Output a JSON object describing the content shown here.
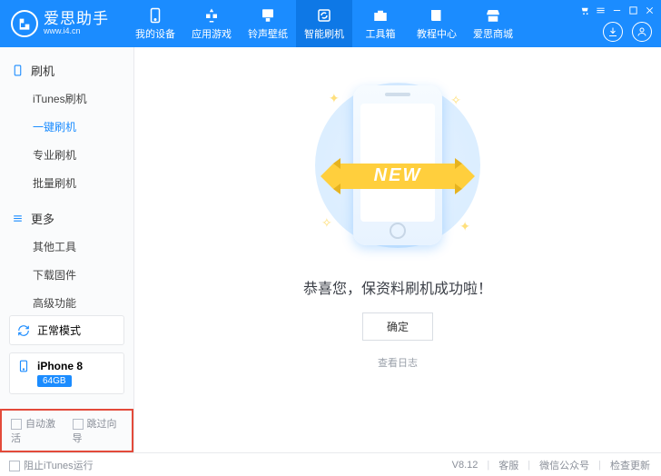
{
  "header": {
    "logo_title": "爱思助手",
    "logo_url": "www.i4.cn",
    "nav": [
      {
        "label": "我的设备",
        "icon": "phone"
      },
      {
        "label": "应用游戏",
        "icon": "apps"
      },
      {
        "label": "铃声壁纸",
        "icon": "music"
      },
      {
        "label": "智能刷机",
        "icon": "refresh"
      },
      {
        "label": "工具箱",
        "icon": "toolbox"
      },
      {
        "label": "教程中心",
        "icon": "book"
      },
      {
        "label": "爱思商城",
        "icon": "store"
      }
    ],
    "nav_active_index": 3
  },
  "sys_icons": [
    "cart-icon",
    "menu-icon",
    "minimize-icon",
    "maximize-icon",
    "close-icon"
  ],
  "header_circles": [
    "download-icon",
    "user-icon"
  ],
  "sidebar": {
    "groups": [
      {
        "title": "刷机",
        "icon": "phone",
        "items": [
          "iTunes刷机",
          "一键刷机",
          "专业刷机",
          "批量刷机"
        ],
        "active_index": 1
      },
      {
        "title": "更多",
        "icon": "more",
        "items": [
          "其他工具",
          "下载固件",
          "高级功能"
        ],
        "active_index": -1
      }
    ],
    "mode": {
      "label": "正常模式"
    },
    "device": {
      "name": "iPhone 8",
      "capacity": "64GB"
    },
    "opts": {
      "auto_activate": "自动激活",
      "skip_guide": "跳过向导"
    }
  },
  "content": {
    "ribbon": "NEW",
    "message": "恭喜您，保资料刷机成功啦！",
    "ok": "确定",
    "view_log": "查看日志"
  },
  "footer": {
    "block_itunes": "阻止iTunes运行",
    "version": "V8.12",
    "links": [
      "客服",
      "微信公众号",
      "检查更新"
    ]
  }
}
